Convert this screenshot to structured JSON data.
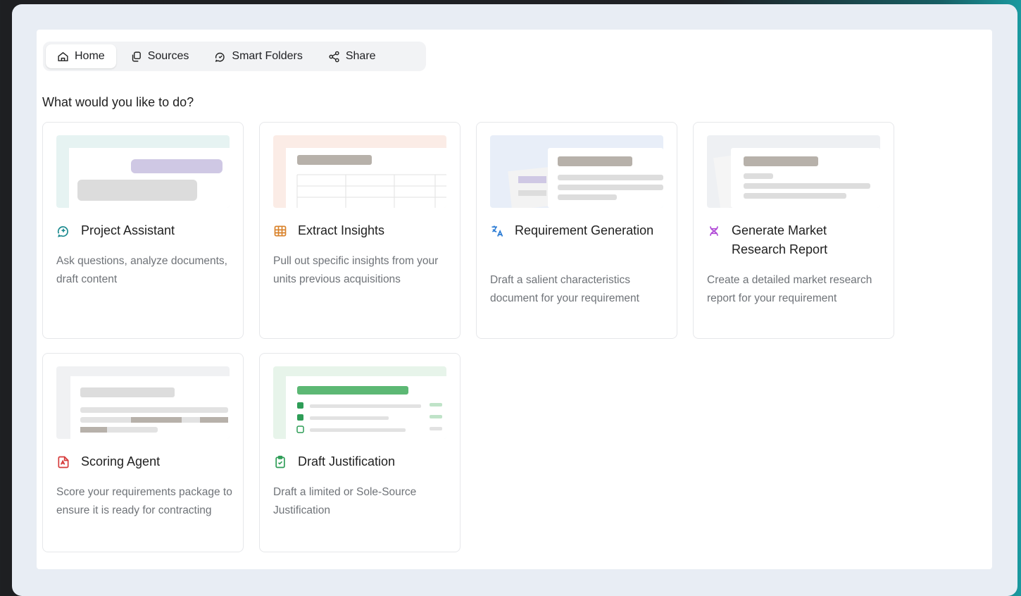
{
  "nav": {
    "tabs": [
      {
        "label": "Home",
        "icon": "home-icon",
        "active": true
      },
      {
        "label": "Sources",
        "icon": "copy-icon",
        "active": false
      },
      {
        "label": "Smart Folders",
        "icon": "smart-folder-icon",
        "active": false
      },
      {
        "label": "Share",
        "icon": "share-icon",
        "active": false
      }
    ]
  },
  "page": {
    "question": "What would you like to do?"
  },
  "cards": [
    {
      "title": "Project Assistant",
      "description": "Ask questions, analyze documents, draft content",
      "icon": "chat-sparkle-icon",
      "icon_color": "#1b8a8f"
    },
    {
      "title": "Extract Insights",
      "description": "Pull out specific insights from your units previous acquisitions",
      "icon": "table-icon",
      "icon_color": "#d9822b"
    },
    {
      "title": "Requirement Generation",
      "description": "Draft a salient characteristics document for your requirement",
      "icon": "translate-icon",
      "icon_color": "#2a7bd4"
    },
    {
      "title": "Generate Market Research Report",
      "description": "Create a detailed market research report for your requirement",
      "icon": "dna-icon",
      "icon_color": "#b04ad6"
    },
    {
      "title": "Scoring Agent",
      "description": "Score your requirements package to ensure it is ready for contracting",
      "icon": "pdf-score-icon",
      "icon_color": "#d63a3a"
    },
    {
      "title": "Draft Justification",
      "description": "Draft a limited or Sole-Source Justification",
      "icon": "clipboard-check-icon",
      "icon_color": "#2e9d57"
    }
  ]
}
